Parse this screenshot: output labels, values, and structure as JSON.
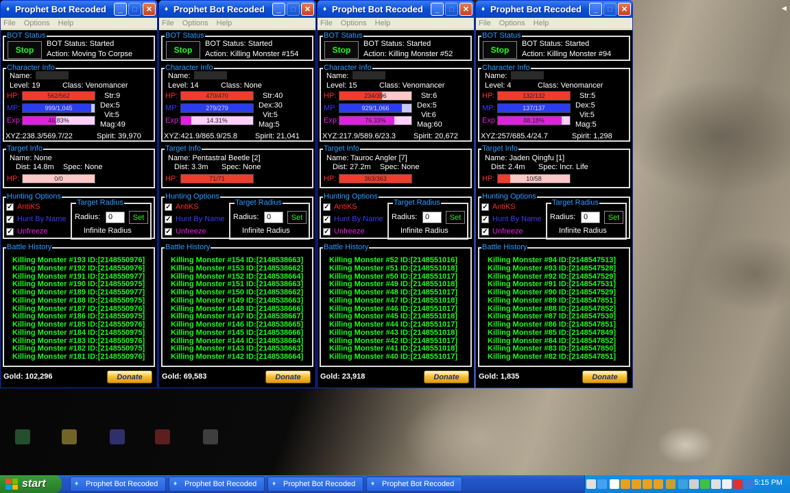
{
  "windows": [
    {
      "title": "Prophet Bot Recoded",
      "menu": [
        "File",
        "Options",
        "Help"
      ],
      "bot_status": {
        "group": "BOT Status",
        "button": "Stop",
        "status": "BOT Status: Started",
        "action": "Action: Moving To Corpse"
      },
      "char": {
        "group": "Character Info",
        "name": "Name:",
        "level": "Level: 19",
        "class": "Class: Venomancer",
        "hp_label": "HP:",
        "hp": "562/562",
        "hp_pct": 1.0,
        "mp_label": "MP:",
        "mp": "999/1,045",
        "mp_pct": 0.956,
        "exp_label": "Exp:",
        "exp": "46.83%",
        "exp_pct": 0.468,
        "str": "Str:9",
        "dex": "Dex:5",
        "vit": "Vit:5",
        "mag": "Mag:49",
        "xyz": "XYZ:238.3/569.7/22",
        "spirit": "Spirit: 39,970"
      },
      "target": {
        "group": "Target Info",
        "name": "Name: None",
        "dist": "Dist: 14.8m",
        "spec": "Spec: None",
        "hp_label": "HP:",
        "hp": "0/0",
        "hp_pct": 0.0
      },
      "hunting": {
        "group": "Hunting Options",
        "antiks": "AntiKS",
        "huntbyname": "Hunt By Name",
        "unfreeze": "Unfreeze",
        "radius_group": "Target Radius",
        "radius_label": "Radius:",
        "radius_value": "0",
        "set": "Set",
        "infinite": "Infinite Radius"
      },
      "history": {
        "group": "Battle History",
        "lines": [
          "Killing Monster #193 ID:[2148550976]",
          "Killing Monster #192 ID:[2148550976]",
          "Killing Monster #191 ID:[2148550977]",
          "Killing Monster #190 ID:[2148550975]",
          "Killing Monster #189 ID:[2148550977]",
          "Killing Monster #188 ID:[2148550975]",
          "Killing Monster #187 ID:[2148550976]",
          "Killing Monster #186 ID:[2148550975]",
          "Killing Monster #185 ID:[2148550976]",
          "Killing Monster #184 ID:[2148550975]",
          "Killing Monster #183 ID:[2148550976]",
          "Killing Monster #182 ID:[2148550975]",
          "Killing Monster #181 ID:[2148550976]"
        ]
      },
      "gold": "Gold: 102,296",
      "donate": "Donate"
    },
    {
      "title": "Prophet Bot Recoded",
      "menu": [
        "File",
        "Options",
        "Help"
      ],
      "bot_status": {
        "group": "BOT Status",
        "button": "Stop",
        "status": "BOT Status: Started",
        "action": "Action: Killing Monster #154"
      },
      "char": {
        "group": "Character Info",
        "name": "Name:",
        "level": "Level: 14",
        "class": "Class: None",
        "hp_label": "HP:",
        "hp": "470/470",
        "hp_pct": 1.0,
        "mp_label": "MP:",
        "mp": "279/279",
        "mp_pct": 1.0,
        "exp_label": "Exp:",
        "exp": "14.31%",
        "exp_pct": 0.143,
        "str": "Str:40",
        "dex": "Dex:30",
        "vit": "Vit:5",
        "mag": "Mag:5",
        "xyz": "XYZ:421.9/865.9/25.8",
        "spirit": "Spirit: 21,041"
      },
      "target": {
        "group": "Target Info",
        "name": "Name: Pentastral Beetle [2]",
        "dist": "Dist: 3.3m",
        "spec": "Spec: None",
        "hp_label": "HP:",
        "hp": "71/71",
        "hp_pct": 1.0
      },
      "hunting": {
        "group": "Hunting Options",
        "antiks": "AntiKS",
        "huntbyname": "Hunt By Name",
        "unfreeze": "Unfreeze",
        "radius_group": "Target Radius",
        "radius_label": "Radius:",
        "radius_value": "0",
        "set": "Set",
        "infinite": "Infinite Radius"
      },
      "history": {
        "group": "Battle History",
        "lines": [
          "Killing Monster #154 ID:[2148538663]",
          "Killing Monster #153 ID:[2148538662]",
          "Killing Monster #152 ID:[2148538664]",
          "Killing Monster #151 ID:[2148538663]",
          "Killing Monster #150 ID:[2148538662]",
          "Killing Monster #149 ID:[2148538663]",
          "Killing Monster #148 ID:[2148538666]",
          "Killing Monster #147 ID:[2148538667]",
          "Killing Monster #146 ID:[2148538665]",
          "Killing Monster #145 ID:[2148538666]",
          "Killing Monster #144 ID:[2148538664]",
          "Killing Monster #143 ID:[2148538663]",
          "Killing Monster #142 ID:[2148538664]"
        ]
      },
      "gold": "Gold: 69,583",
      "donate": "Donate"
    },
    {
      "title": "Prophet Bot Recoded",
      "menu": [
        "File",
        "Options",
        "Help"
      ],
      "bot_status": {
        "group": "BOT Status",
        "button": "Stop",
        "status": "BOT Status: Started",
        "action": "Action: Killing Monster #52"
      },
      "char": {
        "group": "Character Info",
        "name": "Name:",
        "level": "Level: 15",
        "class": "Class: Venomancer",
        "hp_label": "HP:",
        "hp": "234/396",
        "hp_pct": 0.59,
        "mp_label": "MP:",
        "mp": "929/1,066",
        "mp_pct": 0.87,
        "exp_label": "Exp:",
        "exp": "76.33%",
        "exp_pct": 0.763,
        "str": "Str:6",
        "dex": "Dex:5",
        "vit": "Vit:6",
        "mag": "Mag:60",
        "xyz": "XYZ:217.9/589.6/23.3",
        "spirit": "Spirit: 20,672"
      },
      "target": {
        "group": "Target Info",
        "name": "Name: Tauroc Angler [7]",
        "dist": "Dist: 27.2m",
        "spec": "Spec: None",
        "hp_label": "HP:",
        "hp": "363/363",
        "hp_pct": 1.0
      },
      "hunting": {
        "group": "Hunting Options",
        "antiks": "AntiKS",
        "huntbyname": "Hunt By Name",
        "unfreeze": "Unfreeze",
        "radius_group": "Target Radius",
        "radius_label": "Radius:",
        "radius_value": "0",
        "set": "Set",
        "infinite": "Infinite Radius"
      },
      "history": {
        "group": "Battle History",
        "lines": [
          "Killing Monster #52 ID:[2148551016]",
          "Killing Monster #51 ID:[2148551018]",
          "Killing Monster #50 ID:[2148551017]",
          "Killing Monster #49 ID:[2148551018]",
          "Killing Monster #48 ID:[2148551017]",
          "Killing Monster #47 ID:[2148551018]",
          "Killing Monster #46 ID:[2148551017]",
          "Killing Monster #45 ID:[2148551018]",
          "Killing Monster #44 ID:[2148551017]",
          "Killing Monster #43 ID:[2148551018]",
          "Killing Monster #42 ID:[2148551017]",
          "Killing Monster #41 ID:[2148551018]",
          "Killing Monster #40 ID:[2148551017]"
        ]
      },
      "gold": "Gold: 23,918",
      "donate": "Donate"
    },
    {
      "title": "Prophet Bot Recoded",
      "menu": [
        "File",
        "Options",
        "Help"
      ],
      "bot_status": {
        "group": "BOT Status",
        "button": "Stop",
        "status": "BOT Status: Started",
        "action": "Action: Killing Monster #94"
      },
      "char": {
        "group": "Character Info",
        "name": "Name:",
        "level": "Level: 4",
        "class": "Class: Venomancer",
        "hp_label": "HP:",
        "hp": "132/132",
        "hp_pct": 1.0,
        "mp_label": "MP:",
        "mp": "137/137",
        "mp_pct": 1.0,
        "exp_label": "Exp:",
        "exp": "88.18%",
        "exp_pct": 0.882,
        "str": "Str:5",
        "dex": "Dex:5",
        "vit": "Vit:5",
        "mag": "Mag:5",
        "xyz": "XYZ:257/685.4/24.7",
        "spirit": "Spirit: 1,298"
      },
      "target": {
        "group": "Target Info",
        "name": "Name: Jaden Qingfu [1]",
        "dist": "Dist: 2.4m",
        "spec": "Spec: Incr. Life",
        "hp_label": "HP:",
        "hp": "10/58",
        "hp_pct": 0.17
      },
      "hunting": {
        "group": "Hunting Options",
        "antiks": "AntiKS",
        "huntbyname": "Hunt By Name",
        "unfreeze": "Unfreeze",
        "radius_group": "Target Radius",
        "radius_label": "Radius:",
        "radius_value": "0",
        "set": "Set",
        "infinite": "Infinite Radius"
      },
      "history": {
        "group": "Battle History",
        "lines": [
          "Killing Monster #94 ID:[2148547513]",
          "Killing Monster #93 ID:[2148547528]",
          "Killing Monster #92 ID:[2148547529]",
          "Killing Monster #91 ID:[2148547531]",
          "Killing Monster #90 ID:[2148547529]",
          "Killing Monster #89 ID:[2148547851]",
          "Killing Monster #88 ID:[2148547852]",
          "Killing Monster #87 ID:[2148547530]",
          "Killing Monster #86 ID:[2148547851]",
          "Killing Monster #85 ID:[2148547849]",
          "Killing Monster #84 ID:[2148547852]",
          "Killing Monster #83 ID:[2148547850]",
          "Killing Monster #82 ID:[2148547851]"
        ]
      },
      "gold": "Gold: 1,835",
      "donate": "Donate"
    }
  ],
  "taskbar": {
    "start": "start",
    "items": [
      "Prophet Bot Recoded",
      "Prophet Bot Recoded",
      "Prophet Bot Recoded",
      "Prophet Bot Recoded"
    ],
    "clock": "5:15 PM"
  },
  "colors": {
    "hp": "#f03c2c",
    "mp": "#2c3cf0",
    "exp": "#e020e0",
    "history": "#1aff1a",
    "group_label": "#2c9cff"
  }
}
